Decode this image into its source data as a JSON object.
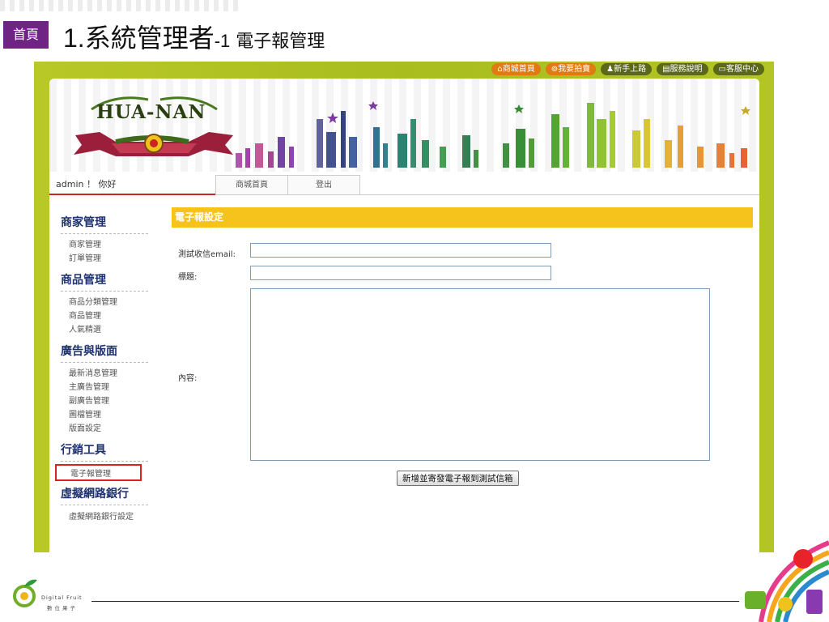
{
  "slide": {
    "home_label": "首頁",
    "title_num": "1.",
    "title_main": "系統管理者",
    "title_sub_num": "-1",
    "title_sub": " 電子報管理"
  },
  "topnav": [
    {
      "label": "商城首頁",
      "icon": "home-icon",
      "style": "orange"
    },
    {
      "label": "我要拍賣",
      "icon": "auction-icon",
      "style": "orange"
    },
    {
      "label": "新手上路",
      "icon": "person-icon",
      "style": "dark"
    },
    {
      "label": "服務說明",
      "icon": "document-icon",
      "style": "dark"
    },
    {
      "label": "客服中心",
      "icon": "chat-icon",
      "style": "dark"
    }
  ],
  "brand": {
    "logo_text": "HUA-NAN"
  },
  "userbar": {
    "greeting": "admin ！ 你好",
    "tabs": [
      "商城首頁",
      "登出"
    ]
  },
  "sidebar": {
    "sections": [
      {
        "title": "商家管理",
        "items": [
          "商家管理",
          "訂單管理"
        ]
      },
      {
        "title": "商品管理",
        "items": [
          "商品分類管理",
          "商品管理",
          "人氣精選"
        ]
      },
      {
        "title": "廣告與版面",
        "items": [
          "最新消息管理",
          "主廣告管理",
          "副廣告管理",
          "圖檔管理",
          "版面設定"
        ]
      },
      {
        "title": "行銷工具",
        "items": [
          "電子報管理"
        ]
      },
      {
        "title": "虛擬網路銀行",
        "items": [
          "虛擬網路銀行設定"
        ]
      }
    ],
    "selected": "電子報管理"
  },
  "form": {
    "heading": "電子報設定",
    "email_label": "測試收信email:",
    "email_value": "",
    "subject_label": "標題:",
    "subject_value": "",
    "content_label": "內容:",
    "content_value": "",
    "submit_label": "新增並寄發電子報到測試信箱"
  },
  "footer": {
    "brand_en": "Digital Fruit",
    "brand_zh": "數位果子"
  },
  "colors": {
    "home_badge": "#6f2384",
    "frame_green": "#b3c524",
    "form_header": "#f5c31b",
    "selected_border": "#e02020",
    "section_title": "#1f3270"
  }
}
